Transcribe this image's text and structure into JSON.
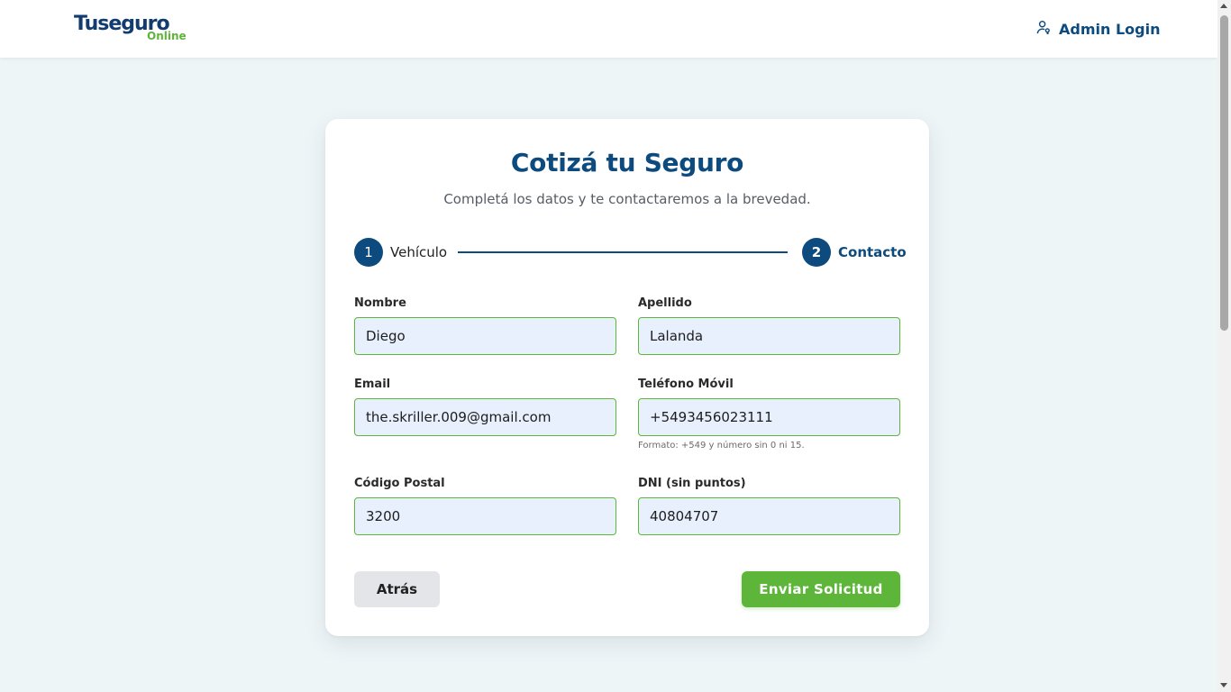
{
  "header": {
    "logo_main": "Tuseguro",
    "logo_sub": "Online",
    "admin_login_label": "Admin Login",
    "admin_icon": "user-key-icon"
  },
  "form": {
    "title": "Cotizá tu Seguro",
    "subtitle": "Completá los datos y te contactaremos a la brevedad.",
    "steps": [
      {
        "number": "1",
        "label": "Vehículo",
        "state": "completed"
      },
      {
        "number": "2",
        "label": "Contacto",
        "state": "active"
      }
    ],
    "fields": {
      "nombre": {
        "label": "Nombre",
        "value": "Diego"
      },
      "apellido": {
        "label": "Apellido",
        "value": "Lalanda"
      },
      "email": {
        "label": "Email",
        "value": "the.skriller.009@gmail.com"
      },
      "telefono": {
        "label": "Teléfono Móvil",
        "value": "+5493456023111",
        "help": "Formato: +549 y número sin 0 ni 15."
      },
      "codigo_postal": {
        "label": "Código Postal",
        "value": "3200"
      },
      "dni": {
        "label": "DNI (sin puntos)",
        "value": "40804707"
      }
    },
    "back_label": "Atrás",
    "submit_label": "Enviar Solicitud"
  },
  "colors": {
    "primary": "#0d4a7d",
    "accent_green": "#5db63a",
    "background": "#eef5f7",
    "input_fill": "#e8f0fe"
  }
}
